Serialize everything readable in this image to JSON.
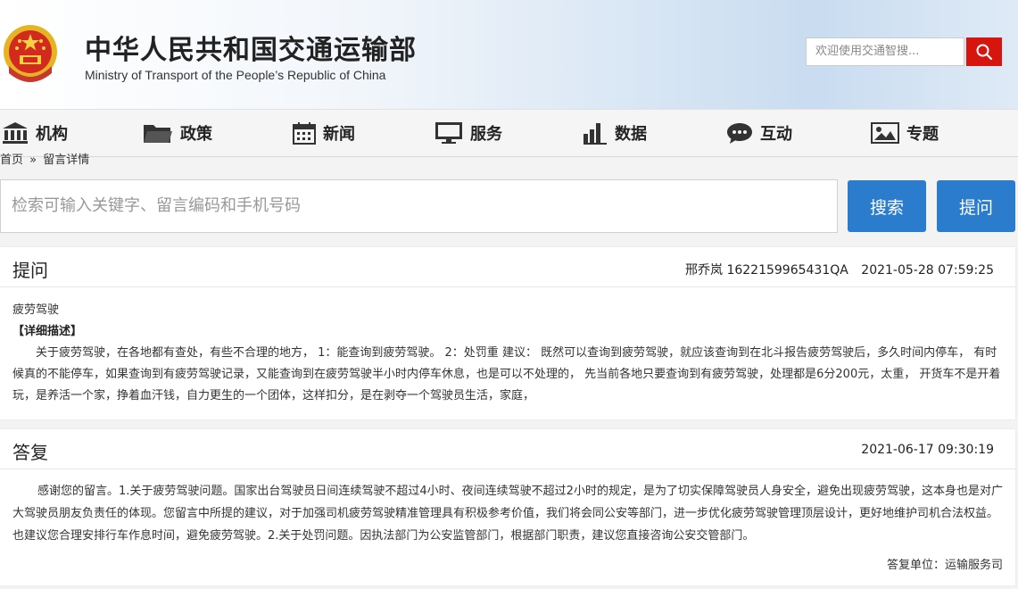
{
  "header": {
    "title": "中华人民共和国交通运输部",
    "subtitle": "Ministry of Transport of the People’s Republic of China",
    "search_placeholder": "欢迎使用交通智搜...",
    "emblem_icon": "national-emblem",
    "search_icon": "search-icon",
    "accent_color": "#d6150f"
  },
  "nav": {
    "items": [
      {
        "label": "机构",
        "icon": "building-icon"
      },
      {
        "label": "政策",
        "icon": "folder-icon"
      },
      {
        "label": "新闻",
        "icon": "calendar-icon"
      },
      {
        "label": "服务",
        "icon": "monitor-icon"
      },
      {
        "label": "数据",
        "icon": "bar-chart-icon"
      },
      {
        "label": "互动",
        "icon": "chat-icon"
      },
      {
        "label": "专题",
        "icon": "image-icon"
      }
    ]
  },
  "breadcrumb": {
    "home": "首页",
    "separator": "»",
    "current": "留言详情"
  },
  "query": {
    "placeholder": "检索可输入关键字、留言编码和手机号码",
    "search_label": "搜索",
    "ask_label": "提问",
    "button_color": "#2b7ccd"
  },
  "question": {
    "heading": "提问",
    "author": "邢乔岚",
    "code": "1622159965431QA",
    "time": "2021-05-28 07:59:25",
    "topic": "疲劳驾驶",
    "detail_label": "【详细描述】",
    "body": "关于疲劳驾驶，在各地都有查处，有些不合理的地方，  1：能查询到疲劳驾驶。 2：处罚重 建议：  既然可以查询到疲劳驾驶，就应该查询到在北斗报告疲劳驾驶后，多久时间内停车，  有时候真的不能停车，如果查询到有疲劳驾驶记录，又能查询到在疲劳驾驶半小时内停车休息，也是可以不处理的，  先当前各地只要查询到有疲劳驾驶，处理都是6分200元，太重，  开货车不是开着玩，是养活一个家，挣着血汗钱，自力更生的一个团体，这样扣分，是在剥夺一个驾驶员生活，家庭，"
  },
  "answer": {
    "heading": "答复",
    "time": "2021-06-17 09:30:19",
    "body": "感谢您的留言。1.关于疲劳驾驶问题。国家出台驾驶员日间连续驾驶不超过4小时、夜间连续驾驶不超过2小时的规定，是为了切实保障驾驶员人身安全，避免出现疲劳驾驶，这本身也是对广大驾驶员朋友负责任的体现。您留言中所提的建议，对于加强司机疲劳驾驶精准管理具有积极参考价值，我们将会同公安等部门，进一步优化疲劳驾驶管理顶层设计，更好地维护司机合法权益。也建议您合理安排行车作息时间，避免疲劳驾驶。2.关于处罚问题。因执法部门为公安监管部门，根据部门职责，建议您直接咨询公安交管部门。",
    "unit_label": "答复单位：",
    "unit": "运输服务司"
  }
}
